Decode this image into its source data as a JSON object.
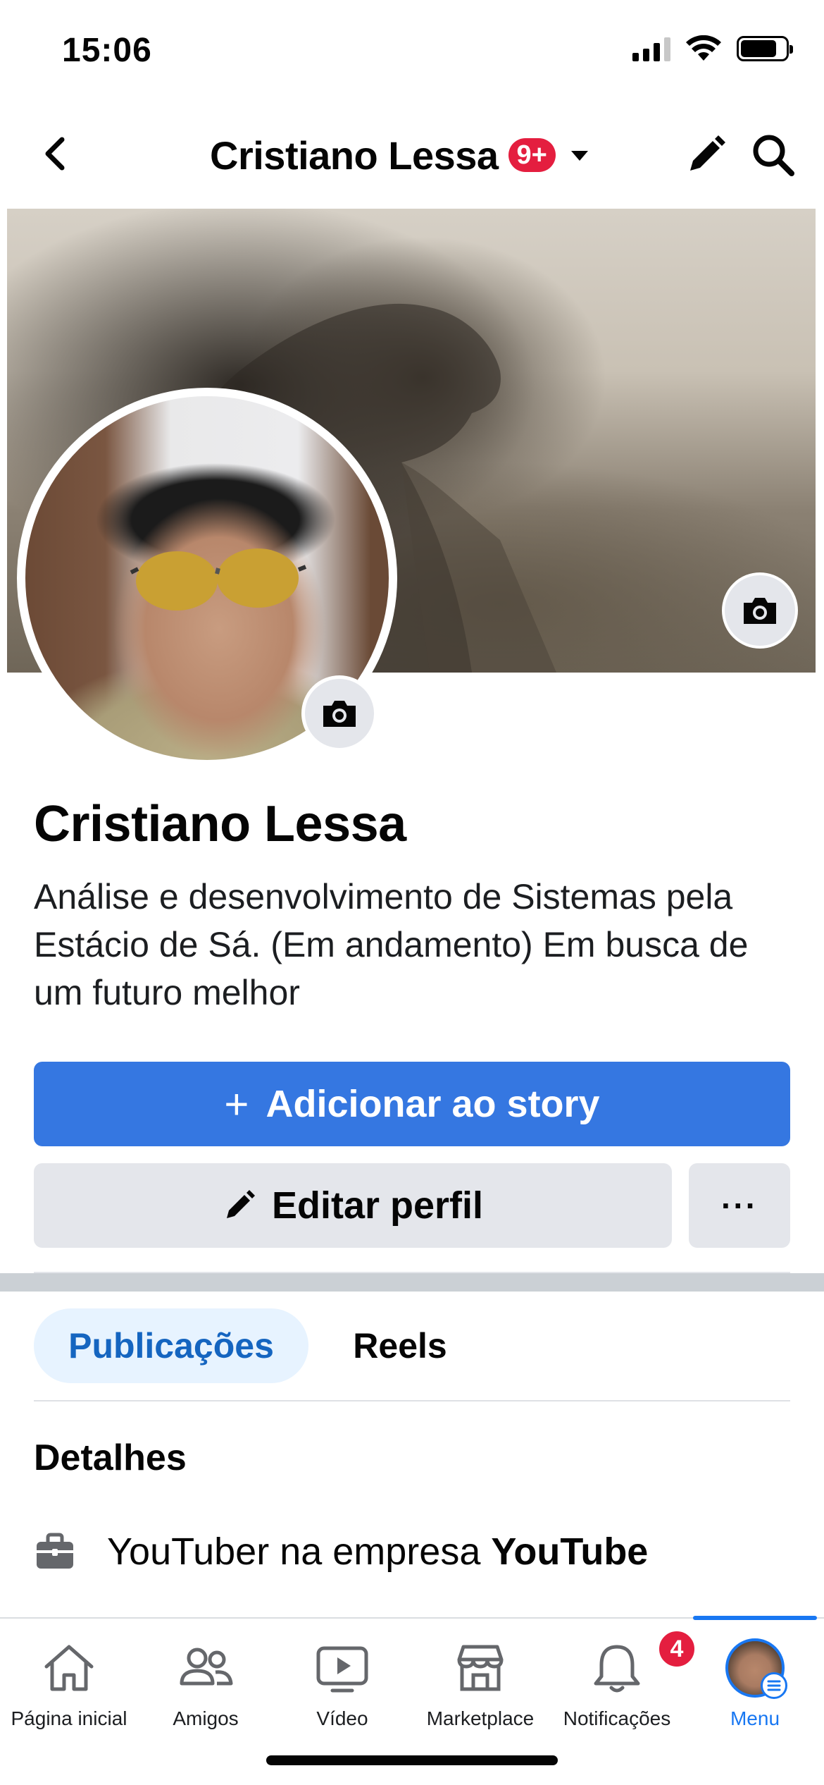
{
  "status_bar": {
    "time": "15:06"
  },
  "header": {
    "title": "Cristiano Lessa",
    "badge": "9+"
  },
  "profile": {
    "name": "Cristiano Lessa",
    "bio": "Análise e desenvolvimento de Sistemas pela Estácio de Sá. (Em andamento) Em busca de um futuro melhor"
  },
  "actions": {
    "add_story": "Adicionar ao story",
    "add_story_icon": "+",
    "edit_profile": "Editar perfil",
    "more": "···"
  },
  "tabs": [
    {
      "label": "Publicações",
      "active": true
    },
    {
      "label": "Reels",
      "active": false
    }
  ],
  "details": {
    "title": "Detalhes",
    "work": {
      "prefix": "YouTuber na empresa",
      "company": "YouTube",
      "icon": "briefcase-icon"
    }
  },
  "bottom_nav": [
    {
      "label": "Página inicial",
      "icon": "home-icon"
    },
    {
      "label": "Amigos",
      "icon": "friends-icon"
    },
    {
      "label": "Vídeo",
      "icon": "video-icon"
    },
    {
      "label": "Marketplace",
      "icon": "marketplace-icon"
    },
    {
      "label": "Notificações",
      "icon": "bell-icon",
      "badge": "4"
    },
    {
      "label": "Menu",
      "icon": "menu-avatar",
      "active": true
    }
  ],
  "colors": {
    "accent": "#3577e1",
    "nav_active": "#1877f2",
    "badge": "#e41e3f",
    "button_gray": "#e4e6eb"
  }
}
